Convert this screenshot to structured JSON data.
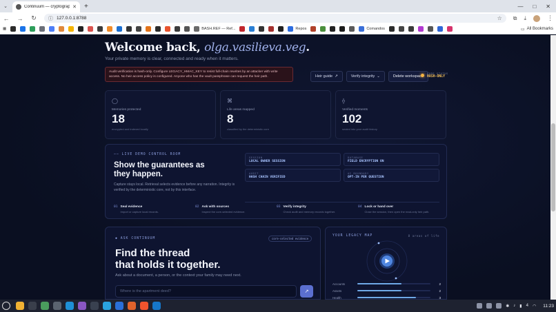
{
  "browser": {
    "tab_title": "Continuum — cryptograph",
    "url": "127.0.0.1:8788",
    "all_bookmarks": "All Bookmarks",
    "bookmarks": [
      {
        "label": "",
        "color": "#2b2b2b"
      },
      {
        "label": "",
        "color": "#1a73e8"
      },
      {
        "label": "",
        "color": "#2e9e5b"
      },
      {
        "label": "",
        "color": "#6b6f78"
      },
      {
        "label": "",
        "color": "#4d7ef7"
      },
      {
        "label": "",
        "color": "#e0883a"
      },
      {
        "label": "",
        "color": "#f4b400"
      },
      {
        "label": "",
        "color": "#222222"
      },
      {
        "label": "",
        "color": "#d9534f"
      },
      {
        "label": "",
        "color": "#3a3a3a"
      },
      {
        "label": "",
        "color": "#f08c2b"
      },
      {
        "label": "",
        "color": "#1b6fd1"
      },
      {
        "label": "",
        "color": "#333333"
      },
      {
        "label": "",
        "color": "#444444"
      },
      {
        "label": "",
        "color": "#e2731a"
      },
      {
        "label": "",
        "color": "#2b2b2b"
      },
      {
        "label": "",
        "color": "#e8542f"
      },
      {
        "label": "",
        "color": "#3b3b3b"
      },
      {
        "label": "",
        "color": "#555555"
      },
      {
        "label": "BASH.REF — Ref...",
        "color": "#6a6a6a"
      },
      {
        "label": "",
        "color": "#c1272d"
      },
      {
        "label": "",
        "color": "#2a7fd4"
      },
      {
        "label": "",
        "color": "#333333"
      },
      {
        "label": "",
        "color": "#a3302e"
      },
      {
        "label": "",
        "color": "#202020"
      },
      {
        "label": "Repos",
        "color": "#2d6de0"
      },
      {
        "label": "",
        "color": "#b0412a"
      },
      {
        "label": "",
        "color": "#4a8f3c"
      },
      {
        "label": "",
        "color": "#222222"
      },
      {
        "label": "",
        "color": "#1b1b1b"
      },
      {
        "label": "",
        "color": "#5a5a5a"
      },
      {
        "label": "Comandos",
        "color": "#3a6fd8"
      },
      {
        "label": "",
        "color": "#2b2b2b"
      },
      {
        "label": "",
        "color": "#444444"
      },
      {
        "label": "",
        "color": "#3a3a3a"
      },
      {
        "label": "",
        "color": "#b23ad1"
      },
      {
        "label": "",
        "color": "#555555"
      },
      {
        "label": "",
        "color": "#2f66d6"
      },
      {
        "label": "",
        "color": "#d6336c"
      }
    ]
  },
  "header": {
    "welcome": "Welcome back,",
    "username": "olga.vasilieva.veg",
    "period": ".",
    "subtitle": "Your private memory is clear, connected and ready when it matters."
  },
  "alert": {
    "text": "Audit verification is hash-only. Configure LEGACY_HMAC_KEY to resist full-chain rewrites by an attacker with write access. No heir access policy is configured. Anyone who has the vault passphrase can request the heir path."
  },
  "actions": {
    "heir_guide": "Heir guide",
    "heir_guide_icon": "↗",
    "verify": "Verify integrity",
    "verify_icon": "⌄",
    "delete": "Delete workspace"
  },
  "core_status": {
    "label": "CORE STATUS",
    "value": "HASH-ONLY",
    "color": "#f5b342"
  },
  "stats": [
    {
      "icon": "◯",
      "label": "Memories protected",
      "value": "18",
      "note": "encrypted and indexed locally"
    },
    {
      "icon": "⌘",
      "label": "Life areas mapped",
      "value": "8",
      "note": "classified by the deterministic core"
    },
    {
      "icon": "⟠",
      "label": "Verified moments",
      "value": "102",
      "note": "sealed into your audit history"
    }
  ],
  "demo": {
    "eyebrow": "—— LIVE DEMO CONTROL ROOM",
    "title": "Show the guarantees as they happen.",
    "description": "Capture stays local. Retrieval selects evidence before any narration. Integrity is verified by the deterministic core, not by this interface.",
    "chips": [
      {
        "key": "SESSION",
        "value": "LOCAL OWNER SESSION"
      },
      {
        "key": "DATABASE",
        "value": "FIELD ENCRYPTION ON"
      },
      {
        "key": "AUDIT",
        "value": "HASH CHAIN VERIFIED"
      },
      {
        "key": "AI BOUNDARY",
        "value": "OPT-IN PER QUESTION"
      }
    ],
    "steps": [
      {
        "num": "01",
        "label": "Seal evidence",
        "desc": "Import or capture local records."
      },
      {
        "num": "02",
        "label": "Ask with sources",
        "desc": "Inspect the core-selected evidence."
      },
      {
        "num": "03",
        "label": "Verify integrity",
        "desc": "Check audit and memory records together."
      },
      {
        "num": "04",
        "label": "Lock or hand over",
        "desc": "Close the session, then open the read-only heir path."
      }
    ]
  },
  "ask": {
    "eyebrow": "◆ ASK CONTINUUM",
    "badge": "core-selected evidence",
    "title_line1": "Find the thread",
    "title_line2": "that holds it together.",
    "hint": "Ask about a document, a person, or the context your family may need next.",
    "placeholder": "Where is the apartment deed?",
    "send_icon": "↗"
  },
  "legacy": {
    "title": "YOUR LEGACY MAP",
    "count": "8 areas of life",
    "rows": [
      {
        "label": "Accounts",
        "value": "2",
        "fraction": 0.6
      },
      {
        "label": "Assets",
        "value": "2",
        "fraction": 0.6
      },
      {
        "label": "Health",
        "value": "3",
        "fraction": 0.8
      }
    ]
  },
  "taskbar": {
    "apps": [
      {
        "name": "files",
        "color": "#f2b233"
      },
      {
        "name": "terminal",
        "color": "#3a3f4b"
      },
      {
        "name": "chrome",
        "color": "#4a9c5d"
      },
      {
        "name": "gimp",
        "color": "#5b6470"
      },
      {
        "name": "vscode-insiders",
        "color": "#1e8fd6"
      },
      {
        "name": "editor",
        "color": "#8a57c4"
      },
      {
        "name": "steam",
        "color": "#394150"
      },
      {
        "name": "telegram",
        "color": "#2aa3df"
      },
      {
        "name": "docs",
        "color": "#2a6fd8"
      },
      {
        "name": "ppt",
        "color": "#e0632b"
      },
      {
        "name": "brave",
        "color": "#f0542d"
      },
      {
        "name": "vscode",
        "color": "#1677c9"
      }
    ],
    "battery": "4",
    "clock": "11:23"
  }
}
